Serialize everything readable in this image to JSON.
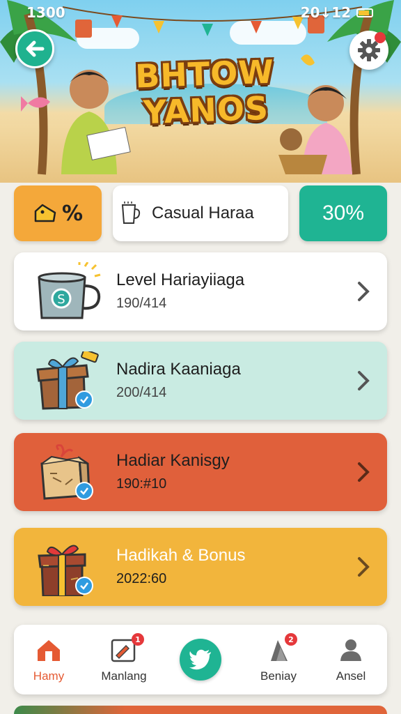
{
  "status_bar": {
    "time": "1300",
    "right_text": "20↓12"
  },
  "hero": {
    "title_line1": "BHTOW",
    "title_line2": "YANOS"
  },
  "quick_stats": {
    "percent_symbol": "%",
    "mode_label": "Casual Haraa",
    "progress": "30%"
  },
  "cards": [
    {
      "title": "Level Hariayiiaga",
      "sub": "190/414",
      "bg": "#ffffff",
      "title_color": "#1e1e1e",
      "sub_color": "#444444"
    },
    {
      "title": "Nadira Kaaniaga",
      "sub": "200/414",
      "bg": "#c9ebe2",
      "title_color": "#1e1e1e",
      "sub_color": "#444444"
    },
    {
      "title": "Hadiar Kanisgy",
      "sub": "190:#10",
      "bg": "#e0603b",
      "title_color": "#1e1e1e",
      "sub_color": "#1e1e1e"
    },
    {
      "title": "Hadikah & Bonus",
      "sub": "2022:60",
      "bg": "#f2b53c",
      "title_color": "#ffffff",
      "sub_color": "#1e1e1e"
    }
  ],
  "nav": {
    "home": "Hamy",
    "manlang": "Manlang",
    "manlang_badge": "1",
    "beniay": "Beniay",
    "beniay_badge": "2",
    "ansel": "Ansel"
  },
  "colors": {
    "accent_green": "#1fb493",
    "accent_orange": "#f4a83a",
    "nav_active": "#e55a33",
    "badge_red": "#e5383b"
  }
}
